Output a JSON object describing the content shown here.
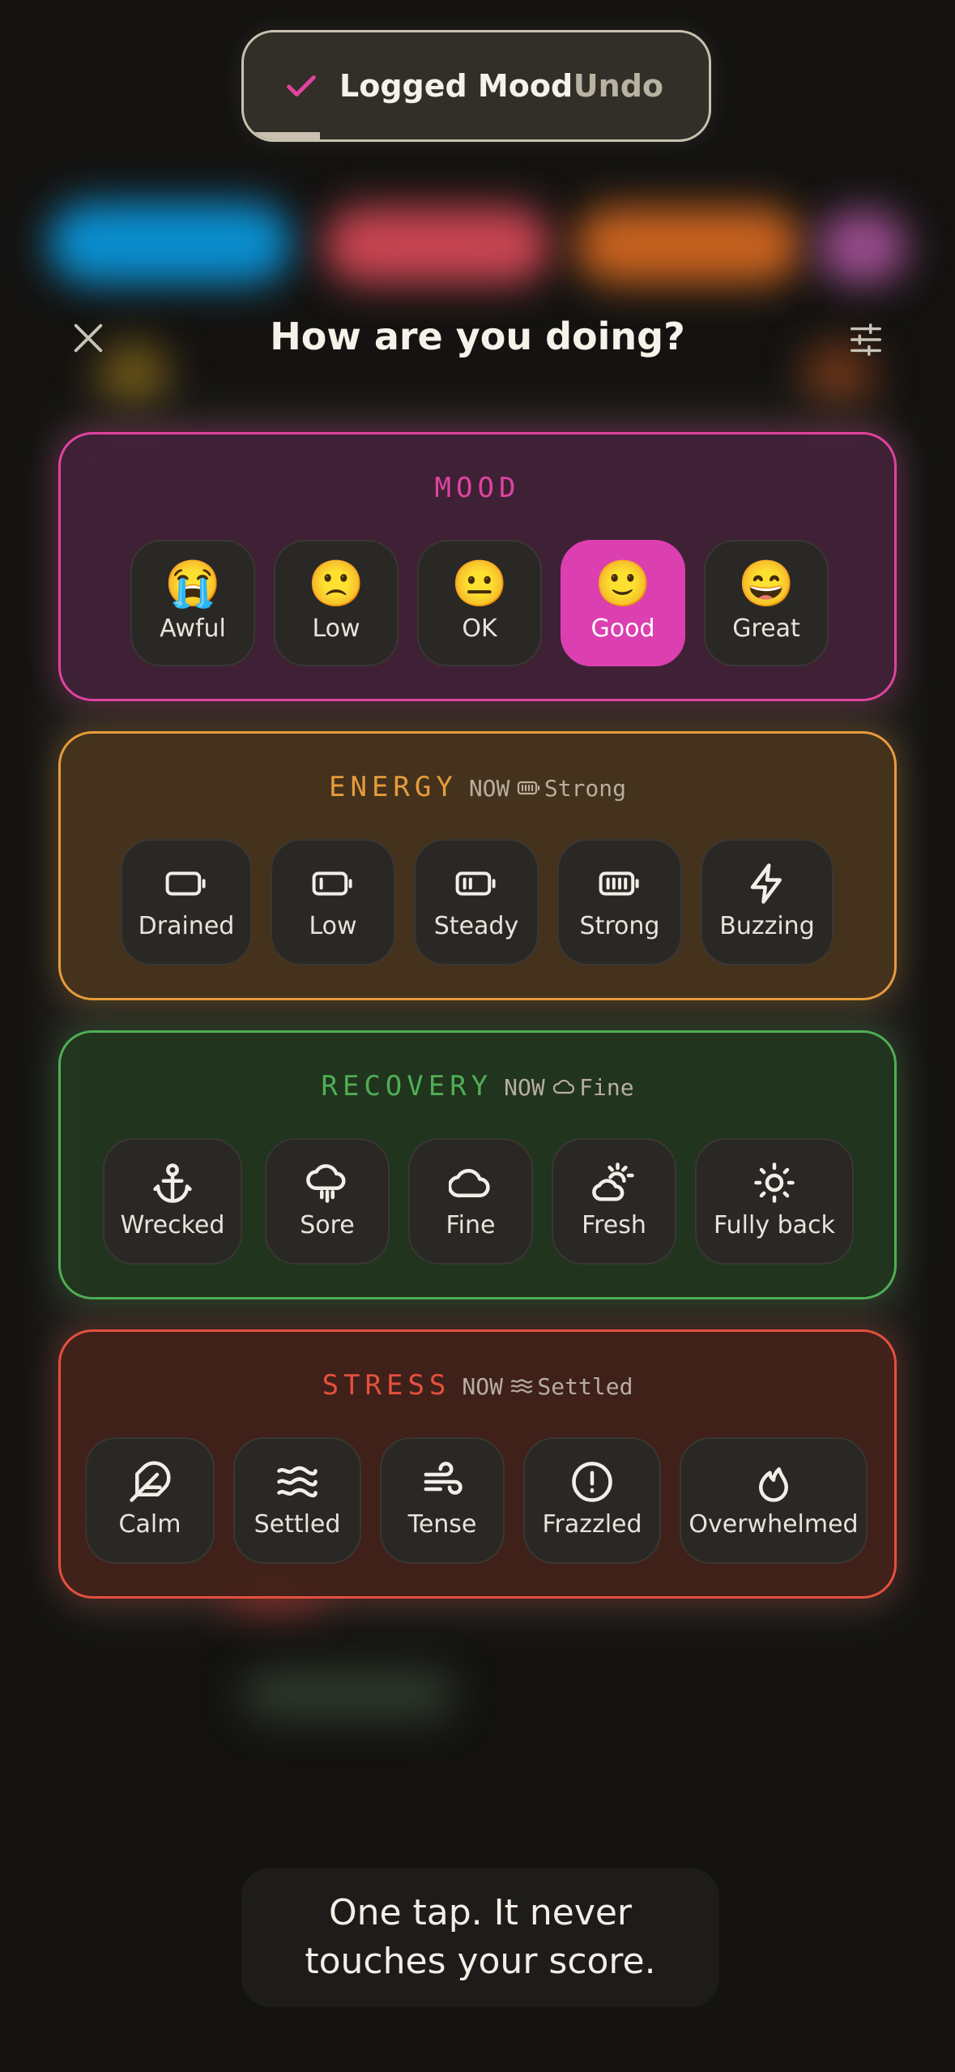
{
  "toast": {
    "message": "Logged Mood",
    "undo_label": "Undo"
  },
  "sheet": {
    "title": "How are you doing?"
  },
  "mood": {
    "label": "MOOD",
    "accent": "#e0439f",
    "selected": "Good",
    "options": [
      {
        "emoji": "😭",
        "label": "Awful"
      },
      {
        "emoji": "🙁",
        "label": "Low"
      },
      {
        "emoji": "😐",
        "label": "OK"
      },
      {
        "emoji": "🙂",
        "label": "Good"
      },
      {
        "emoji": "😄",
        "label": "Great"
      }
    ]
  },
  "energy": {
    "label": "ENERGY",
    "accent": "#e79b3c",
    "now_label": "NOW",
    "now_icon": "battery-strong-icon",
    "now_value": "Strong",
    "options": [
      {
        "icon": "battery-empty-icon",
        "label": "Drained"
      },
      {
        "icon": "battery-low-icon",
        "label": "Low"
      },
      {
        "icon": "battery-medium-icon",
        "label": "Steady"
      },
      {
        "icon": "battery-full-icon",
        "label": "Strong"
      },
      {
        "icon": "lightning-icon",
        "label": "Buzzing"
      }
    ]
  },
  "recovery": {
    "label": "RECOVERY",
    "accent": "#4fae55",
    "now_label": "NOW",
    "now_icon": "cloud-icon",
    "now_value": "Fine",
    "options": [
      {
        "icon": "anchor-icon",
        "label": "Wrecked"
      },
      {
        "icon": "cloud-rain-icon",
        "label": "Sore"
      },
      {
        "icon": "cloud-icon",
        "label": "Fine"
      },
      {
        "icon": "sun-cloud-icon",
        "label": "Fresh"
      },
      {
        "icon": "sun-icon",
        "label": "Fully back"
      }
    ]
  },
  "stress": {
    "label": "STRESS",
    "accent": "#e5503e",
    "now_label": "NOW",
    "now_icon": "waves-icon",
    "now_value": "Settled",
    "options": [
      {
        "icon": "feather-icon",
        "label": "Calm"
      },
      {
        "icon": "waves-icon",
        "label": "Settled"
      },
      {
        "icon": "wind-icon",
        "label": "Tense"
      },
      {
        "icon": "alert-circle-icon",
        "label": "Frazzled"
      },
      {
        "icon": "flame-icon",
        "label": "Overwhelmed"
      }
    ]
  },
  "hint": {
    "text": "One tap. It never touches your score."
  }
}
